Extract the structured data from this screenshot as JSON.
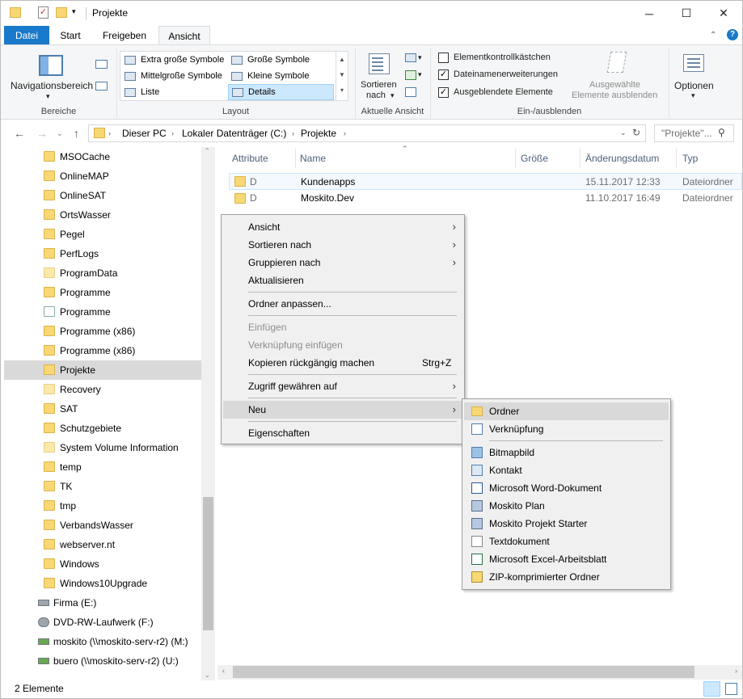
{
  "window": {
    "title": "Projekte",
    "minimize": "─",
    "maximize": "☐",
    "close": "✕"
  },
  "tabs": {
    "datei": "Datei",
    "start": "Start",
    "freigeben": "Freigeben",
    "ansicht": "Ansicht"
  },
  "ribbon": {
    "bereiche": {
      "nav_label": "Navigationsbereich",
      "group": "Bereiche"
    },
    "layout": {
      "items": [
        "Extra große Symbole",
        "Große Symbole",
        "Mittelgroße Symbole",
        "Kleine Symbole",
        "Liste",
        "Details"
      ],
      "selected": "Details",
      "group": "Layout"
    },
    "aktuelle_ansicht": {
      "sort_label_1": "Sortieren",
      "sort_label_2": "nach",
      "group": "Aktuelle Ansicht"
    },
    "einausblenden": {
      "checks": [
        {
          "label": "Elementkontrollkästchen",
          "checked": false
        },
        {
          "label": "Dateinamenerweiterungen",
          "checked": true
        },
        {
          "label": "Ausgeblendete Elemente",
          "checked": true
        }
      ],
      "hide_1": "Ausgewählte",
      "hide_2": "Elemente ausblenden",
      "group": "Ein-/ausblenden"
    },
    "optionen": "Optionen"
  },
  "address": {
    "crumbs": [
      "Dieser PC",
      "Lokaler Datenträger (C:)",
      "Projekte"
    ],
    "search_placeholder": "\"Projekte\"..."
  },
  "nav_items": [
    {
      "label": "MSOCache",
      "type": "folder"
    },
    {
      "label": "OnlineMAP",
      "type": "folder"
    },
    {
      "label": "OnlineSAT",
      "type": "folder"
    },
    {
      "label": "OrtsWasser",
      "type": "folder"
    },
    {
      "label": "Pegel",
      "type": "folder"
    },
    {
      "label": "PerfLogs",
      "type": "folder"
    },
    {
      "label": "ProgramData",
      "type": "folder-pale"
    },
    {
      "label": "Programme",
      "type": "folder"
    },
    {
      "label": "Programme",
      "type": "shortcut"
    },
    {
      "label": "Programme (x86)",
      "type": "folder"
    },
    {
      "label": "Programme (x86)",
      "type": "folder"
    },
    {
      "label": "Projekte",
      "type": "folder",
      "selected": true
    },
    {
      "label": "Recovery",
      "type": "folder-pale"
    },
    {
      "label": "SAT",
      "type": "folder"
    },
    {
      "label": "Schutzgebiete",
      "type": "folder"
    },
    {
      "label": "System Volume Information",
      "type": "folder-pale"
    },
    {
      "label": "temp",
      "type": "folder"
    },
    {
      "label": "TK",
      "type": "folder"
    },
    {
      "label": "tmp",
      "type": "folder"
    },
    {
      "label": "VerbandsWasser",
      "type": "folder"
    },
    {
      "label": "webserver.nt",
      "type": "folder"
    },
    {
      "label": "Windows",
      "type": "folder"
    },
    {
      "label": "Windows10Upgrade",
      "type": "folder"
    },
    {
      "label": "Firma (E:)",
      "type": "drive"
    },
    {
      "label": "DVD-RW-Laufwerk (F:)",
      "type": "dvd"
    },
    {
      "label": "moskito (\\\\moskito-serv-r2) (M:)",
      "type": "net"
    },
    {
      "label": "buero (\\\\moskito-serv-r2) (U:)",
      "type": "net"
    }
  ],
  "columns": {
    "attribute": "Attribute",
    "name": "Name",
    "size": "Größe",
    "date": "Änderungsdatum",
    "type": "Typ"
  },
  "files": [
    {
      "attr": "D",
      "name": "Kundenapps",
      "date": "15.11.2017 12:33",
      "type": "Dateiordner"
    },
    {
      "attr": "D",
      "name": "Moskito.Dev",
      "date": "11.10.2017 16:49",
      "type": "Dateiordner"
    }
  ],
  "context_menu": [
    {
      "label": "Ansicht",
      "submenu": true
    },
    {
      "label": "Sortieren nach",
      "submenu": true
    },
    {
      "label": "Gruppieren nach",
      "submenu": true
    },
    {
      "label": "Aktualisieren"
    },
    {
      "sep": true
    },
    {
      "label": "Ordner anpassen..."
    },
    {
      "sep": true
    },
    {
      "label": "Einfügen",
      "disabled": true
    },
    {
      "label": "Verknüpfung einfügen",
      "disabled": true
    },
    {
      "label": "Kopieren rückgängig machen",
      "shortcut": "Strg+Z"
    },
    {
      "sep": true
    },
    {
      "label": "Zugriff gewähren auf",
      "submenu": true
    },
    {
      "sep": true
    },
    {
      "label": "Neu",
      "submenu": true,
      "hover": true
    },
    {
      "sep": true
    },
    {
      "label": "Eigenschaften"
    }
  ],
  "submenu_neu": [
    {
      "label": "Ordner",
      "icon": "folder-icon",
      "hover": true
    },
    {
      "label": "Verknüpfung",
      "icon": "shortcut-icon"
    },
    {
      "sep": true
    },
    {
      "label": "Bitmapbild",
      "icon": "bitmap-icon"
    },
    {
      "label": "Kontakt",
      "icon": "contact-icon"
    },
    {
      "label": "Microsoft Word-Dokument",
      "icon": "word-icon"
    },
    {
      "label": "Moskito Plan",
      "icon": "moskito-plan-icon"
    },
    {
      "label": "Moskito Projekt Starter",
      "icon": "moskito-starter-icon"
    },
    {
      "label": "Textdokument",
      "icon": "text-document-icon"
    },
    {
      "label": "Microsoft Excel-Arbeitsblatt",
      "icon": "excel-icon"
    },
    {
      "label": "ZIP-komprimierter Ordner",
      "icon": "zip-icon"
    }
  ],
  "status": {
    "count": "2 Elemente"
  },
  "colors": {
    "accent": "#1979ca",
    "selection": "#cce8ff",
    "folder": "#f8d775"
  }
}
